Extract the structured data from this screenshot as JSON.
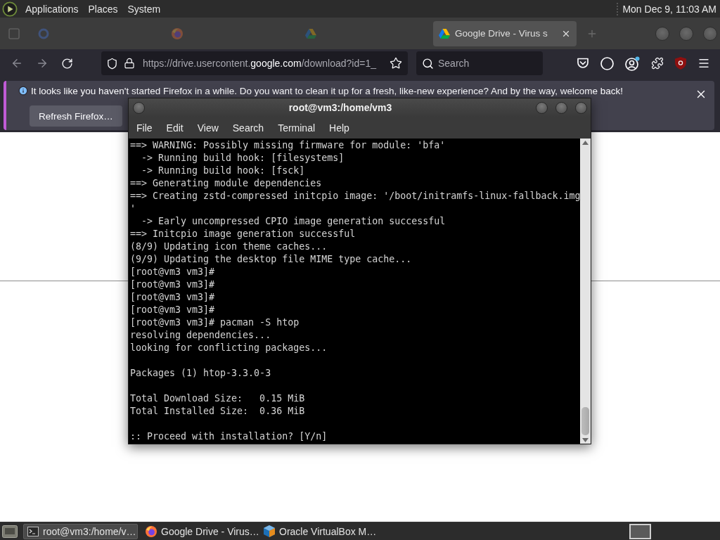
{
  "top_panel": {
    "menus": [
      "Applications",
      "Places",
      "System"
    ],
    "clock": "Mon Dec 9, 11:03 AM"
  },
  "browser": {
    "tabs": [
      {
        "kind": "search",
        "selected": false
      },
      {
        "kind": "firefox",
        "selected": false
      },
      {
        "kind": "drive",
        "selected": false
      },
      {
        "kind": "drive",
        "title": "Google Drive - Virus s",
        "selected": true
      }
    ],
    "address_bar": {
      "url_start": "https://drive.usercontent.",
      "url_domain": "google.com",
      "url_end": "/download?id=1_"
    },
    "search": {
      "placeholder": "Search"
    },
    "notification": {
      "message": "It looks like you haven't started Firefox in a while. Do you want to clean it up for a fresh, like-new experience? And by the way, welcome back!",
      "button": "Refresh Firefox…"
    }
  },
  "terminal": {
    "title": "root@vm3:/home/vm3",
    "menu": [
      "File",
      "Edit",
      "View",
      "Search",
      "Terminal",
      "Help"
    ],
    "lines": [
      {
        "kind": "text",
        "text": "==> WARNING: Possibly missing firmware for module: 'bfa'"
      },
      {
        "kind": "text",
        "text": "  -> Running build hook: [filesystems]"
      },
      {
        "kind": "text",
        "text": "  -> Running build hook: [fsck]"
      },
      {
        "kind": "text",
        "text": "==> Generating module dependencies"
      },
      {
        "kind": "text",
        "text": "==> Creating zstd-compressed initcpio image: '/boot/initramfs-linux-fallback.img"
      },
      {
        "kind": "text",
        "text": "'"
      },
      {
        "kind": "text",
        "text": "  -> Early uncompressed CPIO image generation successful"
      },
      {
        "kind": "text",
        "text": "==> Initcpio image generation successful"
      },
      {
        "kind": "text",
        "text": "(8/9) Updating icon theme caches..."
      },
      {
        "kind": "text",
        "text": "(9/9) Updating the desktop file MIME type cache..."
      },
      {
        "kind": "text",
        "text": "[root@vm3 vm3]#"
      },
      {
        "kind": "text",
        "text": "[root@vm3 vm3]#"
      },
      {
        "kind": "text",
        "text": "[root@vm3 vm3]#"
      },
      {
        "kind": "text",
        "text": "[root@vm3 vm3]#"
      },
      {
        "kind": "text",
        "text": "[root@vm3 vm3]# pacman -S htop"
      },
      {
        "kind": "text",
        "text": "resolving dependencies..."
      },
      {
        "kind": "text",
        "text": "looking for conflicting packages..."
      },
      {
        "kind": "blank"
      },
      {
        "kind": "text",
        "text": "Packages (1) htop-3.3.0-3"
      },
      {
        "kind": "blank"
      },
      {
        "kind": "text",
        "text": "Total Download Size:   0.15 MiB"
      },
      {
        "kind": "text",
        "text": "Total Installed Size:  0.36 MiB"
      },
      {
        "kind": "blank"
      },
      {
        "kind": "text",
        "text": ":: Proceed with installation? [Y/n]"
      }
    ]
  },
  "taskbar": {
    "items": [
      {
        "kind": "terminal",
        "label": "root@vm3:/home/v…",
        "selected": true
      },
      {
        "kind": "firefox",
        "label": "Google Drive - Virus…",
        "selected": false
      },
      {
        "kind": "virtualbox",
        "label": "Oracle VirtualBox M…",
        "selected": false
      }
    ]
  }
}
